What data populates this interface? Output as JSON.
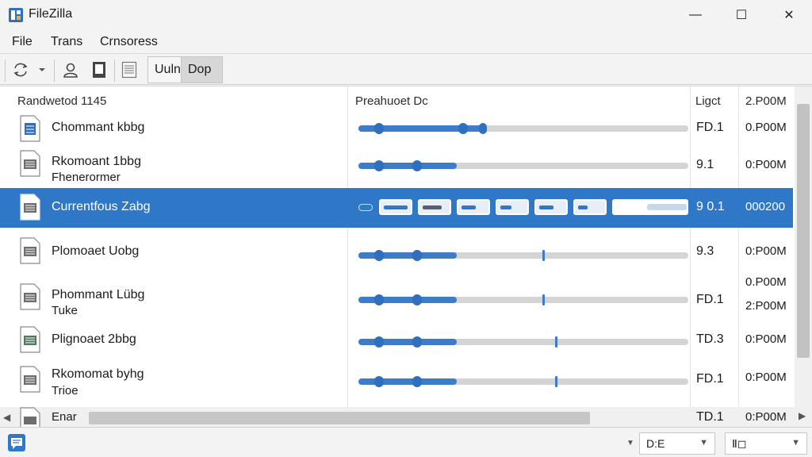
{
  "window": {
    "title": "FileZilla",
    "minimize_glyph": "—",
    "maximize_glyph": "☐",
    "close_glyph": "✕"
  },
  "menu": {
    "items": [
      "File",
      "Trans",
      "Crnsoress"
    ]
  },
  "toolbar": {
    "icons": [
      "sync-icon",
      "dropdown-arrow-icon",
      "user-icon",
      "server-icon",
      "document-icon"
    ],
    "tab_a_label": "Uuln",
    "tab_b_label": "Dop"
  },
  "list": {
    "headers": {
      "name": "Randwetod 1145",
      "progress": "Preahuoet Dc",
      "value": "Ligct",
      "size": "2.P00M"
    },
    "rows": [
      {
        "name": "Chommant kbbg",
        "subname": "",
        "value": "FD.1",
        "size": "0.P00M",
        "size2": "",
        "progress": 0.38,
        "selected": false
      },
      {
        "name": "Rkomoant 1bbg",
        "subname": "Fhenerormer",
        "value": "9.1",
        "size": "0:P00M",
        "size2": "",
        "progress": 0.3,
        "selected": false
      },
      {
        "name": "Currentfous Zabg",
        "subname": "",
        "value": "9 0.1",
        "size": "000200",
        "size2": "",
        "progress": 0.82,
        "selected": true
      },
      {
        "name": "Plomoaet Uobg",
        "subname": "",
        "value": "9.3",
        "size": "0:P00M",
        "size2": "",
        "progress": 0.3,
        "selected": false
      },
      {
        "name": "Phommant Lübg",
        "subname": "Tuke",
        "value": "FD.1",
        "size": "0.P00M",
        "size2": "2:P00M",
        "progress": 0.3,
        "selected": false
      },
      {
        "name": "Plignoaet 2bbg",
        "subname": "",
        "value": "TD.3",
        "size": "0:P00M",
        "size2": "",
        "progress": 0.3,
        "selected": false
      },
      {
        "name": "Rkomomat byhg",
        "subname": "Trioe",
        "value": "FD.1",
        "size": "0:P00M",
        "size2": "",
        "progress": 0.3,
        "selected": false
      },
      {
        "name": "Enar",
        "subname": "",
        "value": "TD.1",
        "size": "0:P00M",
        "size2": "",
        "progress": 0,
        "selected": false
      }
    ]
  },
  "statusbar": {
    "combo1_label": "D:E",
    "combo2_label": "Ⅱ◻"
  },
  "colors": {
    "accent": "#2f78c8",
    "selection": "#2f78c8",
    "track": "#d4d4d4"
  }
}
